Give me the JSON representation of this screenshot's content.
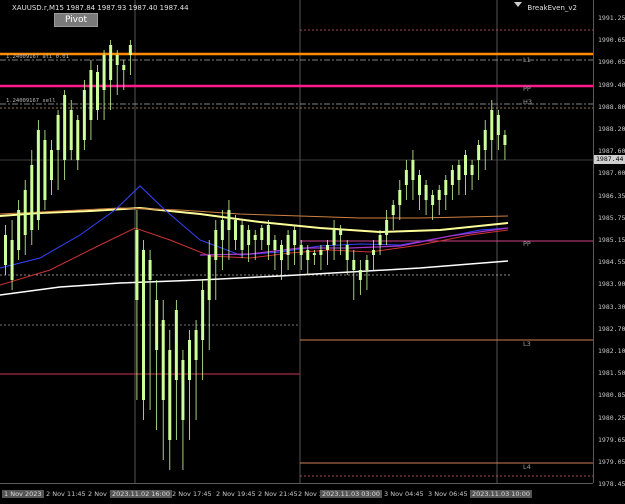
{
  "header": {
    "symbol_line": "XAUUSD.r,M15  1987.84 1987.93 1987.40 1987.44",
    "indicator_name": "BreakEven_v2"
  },
  "pivot_button": {
    "label": "Pivot"
  },
  "price_axis": {
    "labels": [
      "1991.25",
      "1990.65",
      "1990.05",
      "1989.40",
      "1988.80",
      "1988.20",
      "1987.60",
      "1987.00",
      "1986.35",
      "1985.75",
      "1985.15",
      "1984.55",
      "1983.90",
      "1983.30",
      "1982.70",
      "1982.10",
      "1981.50",
      "1980.85",
      "1980.25",
      "1979.65",
      "1979.05",
      "1978.45"
    ],
    "current_price": "1987.44"
  },
  "time_axis": {
    "labels": [
      {
        "text": "1 Nov 2023",
        "highlight": true
      },
      {
        "text": "2 Nov 11:45",
        "highlight": false
      },
      {
        "text": "2 Nov 14:45",
        "highlight": false
      },
      {
        "text": "2023.11.02 16:00",
        "highlight": true
      },
      {
        "text": "2 Nov 17:45",
        "highlight": false
      },
      {
        "text": "2 Nov 19:45",
        "highlight": false
      },
      {
        "text": "2 Nov 21:45",
        "highlight": false
      },
      {
        "text": "2 Nov 2",
        "highlight": false
      },
      {
        "text": "2023.11.03 03:00",
        "highlight": true
      },
      {
        "text": "3 Nov 04:45",
        "highlight": false
      },
      {
        "text": "3 Nov 06:45",
        "highlight": false
      },
      {
        "text": "2023.11.03 10:00",
        "highlight": true
      }
    ]
  },
  "levels": {
    "h3": "H3",
    "pp_upper": "PP",
    "l1_upper": "L1",
    "pp_mid": "PP",
    "l3": "L3",
    "l4": "L4",
    "small_label_1": "1.24009167 ati 0.01",
    "small_label_2": "1.24009167 sell"
  },
  "colors": {
    "candle": "#ccff99",
    "orange_line": "#ff8c00",
    "magenta_line": "#ff1a8c",
    "sma_white": "#ffffff",
    "sma_yellow": "#ffff99",
    "sma_red": "#cc3333",
    "sma_blue": "#3344ff",
    "sma_purple": "#aa33cc",
    "sma_orange": "#d08040"
  }
}
